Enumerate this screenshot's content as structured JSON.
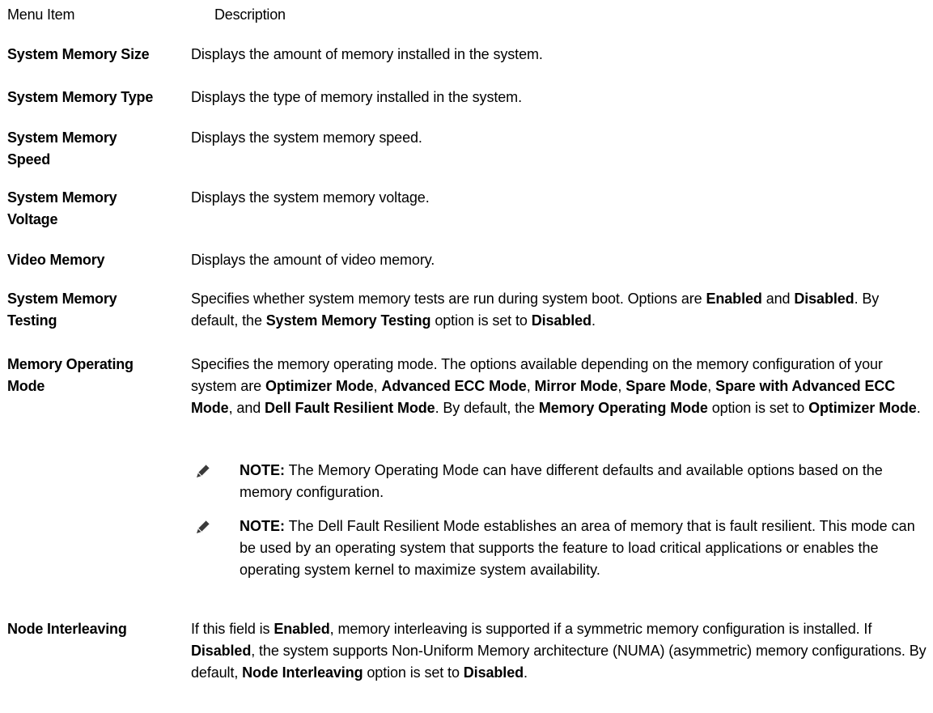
{
  "header": {
    "item": "Menu Item",
    "description": "Description"
  },
  "rows": [
    {
      "item": "System Memory Size",
      "description": "Displays the amount of memory installed in the system."
    },
    {
      "item": "System Memory Type",
      "description": "Displays the type of memory installed in the system."
    },
    {
      "item": "System Memory Speed",
      "description": "Displays the system memory speed."
    },
    {
      "item": "System Memory Voltage",
      "description": "Displays the system memory voltage."
    },
    {
      "item": "Video Memory",
      "description": "Displays the amount of video memory."
    },
    {
      "item": "System Memory Testing",
      "description_parts": [
        {
          "t": "Specifies whether system memory tests are run during system boot. Options are "
        },
        {
          "t": "Enabled",
          "b": true
        },
        {
          "t": " and "
        },
        {
          "t": "Disabled",
          "b": true
        },
        {
          "t": ". By default, the "
        },
        {
          "t": "System Memory Testing",
          "b": true
        },
        {
          "t": " option is set to "
        },
        {
          "t": "Disabled",
          "b": true
        },
        {
          "t": "."
        }
      ]
    },
    {
      "item": "Memory Operating Mode",
      "description_parts": [
        {
          "t": "Specifies the memory operating mode. The options available depending on the memory configuration of your system are "
        },
        {
          "t": "Optimizer Mode",
          "b": true
        },
        {
          "t": ", "
        },
        {
          "t": "Advanced ECC Mode",
          "b": true
        },
        {
          "t": ", "
        },
        {
          "t": "Mirror Mode",
          "b": true
        },
        {
          "t": ", "
        },
        {
          "t": "Spare Mode",
          "b": true
        },
        {
          "t": ", "
        },
        {
          "t": "Spare with Advanced ECC Mode",
          "b": true
        },
        {
          "t": ", and "
        },
        {
          "t": "Dell Fault Resilient Mode",
          "b": true
        },
        {
          "t": ". By default, the "
        },
        {
          "t": "Memory Operating Mode",
          "b": true
        },
        {
          "t": " option is set to "
        },
        {
          "t": "Optimizer Mode",
          "b": true
        },
        {
          "t": "."
        }
      ],
      "notes": [
        {
          "label": "NOTE:",
          "text": " The Memory Operating Mode can have different defaults and available options based on the memory configuration."
        },
        {
          "label": "NOTE:",
          "text": " The Dell Fault Resilient Mode establishes an area of memory that is fault resilient. This mode can be used by an operating system that supports the feature to load critical applications or enables the operating system kernel to maximize system availability."
        }
      ]
    },
    {
      "item": "Node Interleaving",
      "description_parts": [
        {
          "t": "If this field is "
        },
        {
          "t": "Enabled",
          "b": true
        },
        {
          "t": ", memory interleaving is supported if a symmetric memory configuration is installed. If "
        },
        {
          "t": "Disabled",
          "b": true
        },
        {
          "t": ", the system supports Non-Uniform Memory architecture (NUMA) (asymmetric) memory configurations. By default, "
        },
        {
          "t": "Node Interleaving",
          "b": true
        },
        {
          "t": " option is set to "
        },
        {
          "t": "Disabled",
          "b": true
        },
        {
          "t": "."
        }
      ]
    }
  ],
  "icons": {
    "note": "note-pencil-icon"
  }
}
